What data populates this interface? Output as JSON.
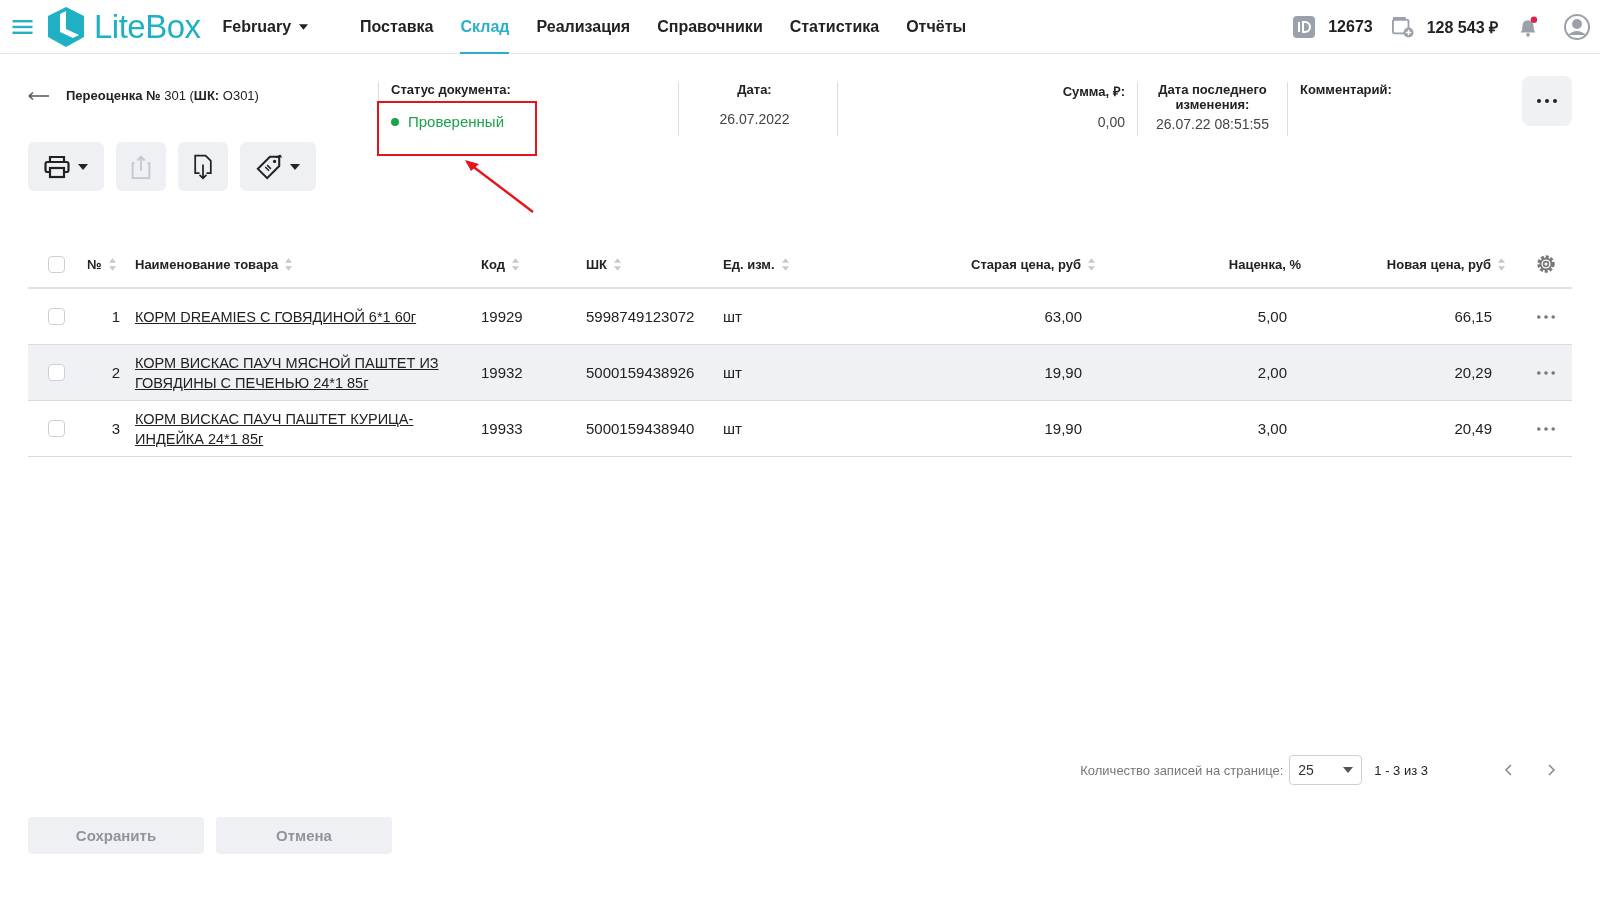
{
  "header": {
    "logo": "LiteBox",
    "period": "February",
    "nav": [
      {
        "label": "Поставка",
        "selected": false
      },
      {
        "label": "Склад",
        "selected": true
      },
      {
        "label": "Реализация",
        "selected": false
      },
      {
        "label": "Справочники",
        "selected": false
      },
      {
        "label": "Статистика",
        "selected": false
      },
      {
        "label": "Отчёты",
        "selected": false
      }
    ],
    "id": "12673",
    "balance": "128 543 ₽",
    "notification": true
  },
  "document": {
    "title": "**Переоценка №** 301 (**ШК:** О301)",
    "status_label": "Статус документа:",
    "status": "Проверенный",
    "date_label": "Дата:",
    "date": "26.07.2022",
    "sum_label": "Сумма, ₽:",
    "sum": "0,00",
    "changed_label": "Дата последнего изменения:",
    "changed": "26.07.22 08:51:55",
    "comment_label": "Комментарий:"
  },
  "toolbar": [
    {
      "kind": "print",
      "dropdown": true,
      "disabled": false
    },
    {
      "kind": "upload",
      "dropdown": false,
      "disabled": true
    },
    {
      "kind": "download",
      "dropdown": false,
      "disabled": false
    },
    {
      "kind": "tag",
      "dropdown": true,
      "disabled": false
    }
  ],
  "table": {
    "columns": [
      {
        "label": "№",
        "sortable": true
      },
      {
        "label": "Наименование товара",
        "sortable": true
      },
      {
        "label": "Код",
        "sortable": true
      },
      {
        "label": "ШК",
        "sortable": true
      },
      {
        "label": "Ед. изм.",
        "sortable": true
      },
      {
        "label": "Старая цена, руб",
        "sortable": true
      },
      {
        "label": "Наценка, %",
        "sortable": false
      },
      {
        "label": "Новая цена, руб",
        "sortable": true
      }
    ],
    "rows": [
      {
        "num": "1",
        "name": "КОРМ DREAMIES С ГОВЯДИНОЙ 6*1 60г",
        "code": "19929",
        "barcode": "5998749123072",
        "unit": "шт",
        "old_price": "63,00",
        "markup": "5,00",
        "new_price": "66,15",
        "checked": false,
        "selected": false
      },
      {
        "num": "2",
        "name": "КОРМ ВИСКАС ПАУЧ МЯСНОЙ ПАШТЕТ ИЗ ГОВЯДИНЫ С ПЕЧЕНЬЮ 24*1 85г",
        "code": "19932",
        "barcode": "5000159438926",
        "unit": "шт",
        "old_price": "19,90",
        "markup": "2,00",
        "new_price": "20,29",
        "checked": false,
        "selected": true
      },
      {
        "num": "3",
        "name": "КОРМ ВИСКАС ПАУЧ ПАШТЕТ КУРИЦА-ИНДЕЙКА 24*1 85г",
        "code": "19933",
        "barcode": "5000159438940",
        "unit": "шт",
        "old_price": "19,90",
        "markup": "3,00",
        "new_price": "20,49",
        "checked": false,
        "selected": false
      }
    ],
    "all_checked": false
  },
  "pagination": {
    "label": "Количество записей на странице:",
    "page_size": "25",
    "range": "1 - 3 из 3"
  },
  "buttons": [
    {
      "label": "Сохранить",
      "disabled": true
    },
    {
      "label": "Отмена",
      "disabled": true
    }
  ]
}
